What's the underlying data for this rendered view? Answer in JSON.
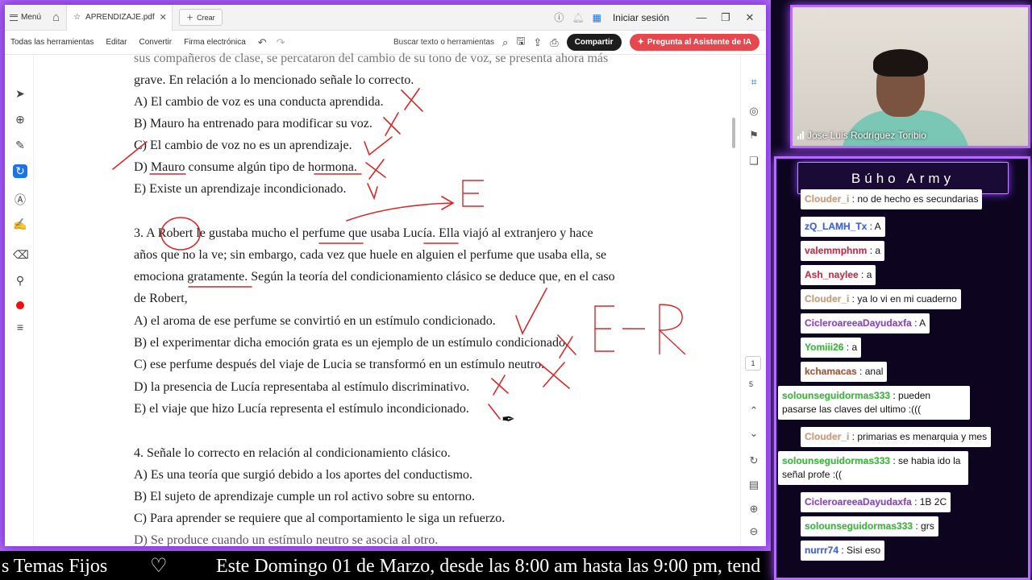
{
  "app": {
    "menu_label": "Menú",
    "tab_title": "APRENDIZAJE.pdf",
    "new_tab_label": "Crear",
    "signin_label": "Iniciar sesión"
  },
  "toolbar": {
    "all_tools": "Todas las herramientas",
    "edit": "Editar",
    "convert": "Convertir",
    "esign": "Firma electrónica",
    "search_placeholder": "Buscar texto o herramientas",
    "share_label": "Compartir",
    "ai_label": "Pregunta al Asistente de IA"
  },
  "pager": {
    "current": "1",
    "total": "5"
  },
  "document": {
    "lines": [
      "sus compañeros de clase, se percataron del cambio de su tono de voz, se presenta ahora más",
      "grave. En relación a lo mencionado señale lo correcto.",
      "A) El cambio de voz es una conducta aprendida.",
      "B) Mauro ha entrenado para modificar su voz.",
      "C) El cambio de voz no es un aprendizaje.",
      "D) Mauro consume algún tipo de hormona.",
      "E) Existe un aprendizaje incondicionado.",
      "3. A Robert le gustaba mucho el perfume que usaba Lucía. Ella viajó al extranjero y hace",
      "años que no la ve; sin embargo, cada vez que huele en alguien el perfume que usaba ella, se",
      "emociona gratamente. Según la teoría del condicionamiento clásico se deduce que, en el caso",
      "de Robert,",
      "A) el aroma de ese perfume se convirtió en un estímulo condicionado.",
      "B) el experimentar dicha emoción grata es un ejemplo de un estímulo condicionado.",
      "C) ese perfume después del viaje de Lucia se transformó en un estímulo neutro.",
      "D) la presencia de Lucía representaba al estímulo discriminativo.",
      "E) el viaje que hizo Lucía representa el estímulo incondicionado.",
      "4. Señale lo correcto en relación al condicionamiento clásico.",
      "A) Es una teoría que surgió debido a los aportes del conductismo.",
      "B) El sujeto de aprendizaje cumple un rol activo sobre su entorno.",
      "C) Para aprender se requiere que al comportamiento le siga un refuerzo.",
      "D) Se produce cuando un estímulo neutro se asocia al otro."
    ],
    "annotations": {
      "e_label": "E",
      "er_label": "E - R"
    }
  },
  "ticker": {
    "left_text": "s Temas Fijos",
    "heart": "♡",
    "main_text": "Este Domingo 01 de Marzo, desde las 8:00 am hasta las 9:00 pm, tend"
  },
  "webcam": {
    "name": "Jose Luis Rodríguez Toribio"
  },
  "chat": {
    "title": "Búho Army",
    "messages": [
      {
        "user": "Clouder_i",
        "text": ": no de hecho es secundarias",
        "color": "#c9a27a"
      },
      {
        "user": "zQ_LAMH_Tx",
        "text": ": A",
        "color": "#3f63d8"
      },
      {
        "user": "valemmphnm",
        "text": ": a",
        "color": "#c4314b"
      },
      {
        "user": "Ash_naylee",
        "text": ": a",
        "color": "#c4314b"
      },
      {
        "user": "Clouder_i",
        "text": ": ya lo vi en mi cuaderno",
        "color": "#c9a27a"
      },
      {
        "user": "CicleroareeaDayudaxfa",
        "text": ": A",
        "color": "#8e44c6"
      },
      {
        "user": "Yomiii26",
        "text": ": a",
        "color": "#3cba3c"
      },
      {
        "user": "kchamacas",
        "text": ": anal",
        "color": "#a05a3a"
      },
      {
        "user": "solounseguidormas333",
        "text": ": pueden pasarse las claves del ultimo :(((",
        "color": "#3cba3c"
      },
      {
        "user": "Clouder_i",
        "text": ": primarias es menarquia y mes",
        "color": "#c9a27a"
      },
      {
        "user": "solounseguidormas333",
        "text": ": se habia ido la señal profe :((",
        "color": "#3cba3c"
      },
      {
        "user": "CicleroareeaDayudaxfa",
        "text": ": 1B 2C",
        "color": "#8e44c6"
      },
      {
        "user": "solounseguidormas333",
        "text": ": grs",
        "color": "#3cba3c"
      },
      {
        "user": "nurrr74",
        "text": ": Sisi eso",
        "color": "#3f63d8"
      }
    ]
  },
  "colors": {
    "frame": "#7b2fd8",
    "ink": "#d42a2a",
    "share": "#1d1d1d",
    "ai": "#e5484d"
  }
}
